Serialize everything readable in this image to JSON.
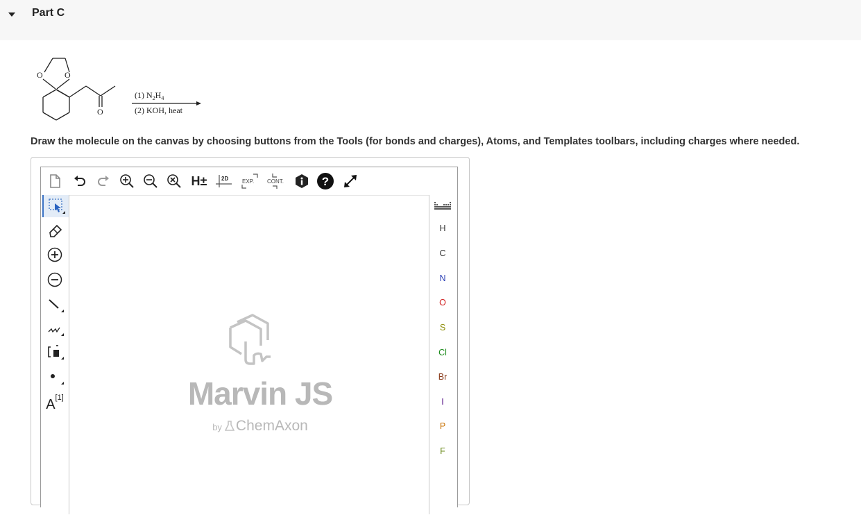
{
  "part": {
    "title": "Part C"
  },
  "reaction": {
    "step1": "(1) N",
    "step1_sub1": "2",
    "step1_h": "H",
    "step1_sub2": "4",
    "step2": "(2) KOH, heat",
    "atom_o": "O"
  },
  "instructions": "Draw the molecule on the canvas by choosing buttons from the Tools (for bonds and charges), Atoms, and Templates toolbars, including charges where needed.",
  "toolbar": {
    "h_toggle": "H±",
    "clean2d": "2D",
    "expand": "EXP.",
    "contract": "CONT."
  },
  "left_toolbar": {
    "atom_map": "[1]",
    "atom_map_letter": "A"
  },
  "atoms": [
    "H",
    "C",
    "N",
    "O",
    "S",
    "Cl",
    "Br",
    "I",
    "P",
    "F"
  ],
  "atom_colors": {
    "H": "#333333",
    "C": "#333333",
    "N": "#2b3fb5",
    "O": "#d02020",
    "S": "#8a8a00",
    "Cl": "#1a8a1a",
    "Br": "#8a3a1a",
    "I": "#5a1a8a",
    "P": "#c87000",
    "F": "#6a8a1a"
  },
  "brand": {
    "name": "Marvin JS",
    "by": "by",
    "company": "ChemAxon"
  }
}
